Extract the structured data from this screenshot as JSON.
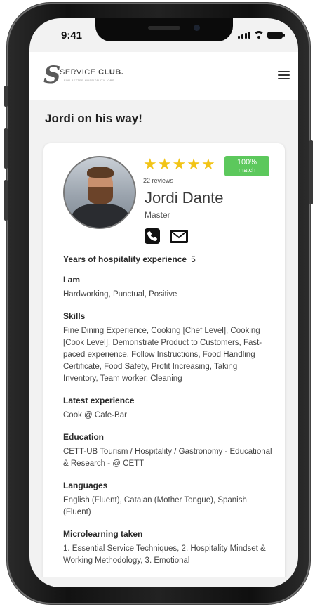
{
  "status_bar": {
    "time": "9:41"
  },
  "header": {
    "logo_mark": "S",
    "logo_primary": "SERVICE",
    "logo_bold": "CLUB.",
    "logo_tagline": "FOR BETTER HOSPITALITY JOBS"
  },
  "page": {
    "title": "Jordi on his way!"
  },
  "profile": {
    "rating": 5,
    "stars": [
      "★",
      "★",
      "★",
      "★",
      "★"
    ],
    "reviews": "22 reviews",
    "match_percent": "100%",
    "match_label": "match",
    "name": "Jordi Dante",
    "role": "Master",
    "colors": {
      "star": "#f2c417",
      "match_badge": "#5cc85c"
    }
  },
  "experience": {
    "label": "Years of hospitality experience",
    "value": "5"
  },
  "sections": [
    {
      "heading": "I am",
      "text": "Hardworking, Punctual, Positive"
    },
    {
      "heading": "Skills",
      "text": "Fine Dining Experience, Cooking [Chef Level], Cooking [Cook Level], Demonstrate Product to Customers, Fast-paced experience, Follow Instructions, Food Handling Certificate, Food Safety, Profit Increasing, Taking Inventory, Team worker, Cleaning"
    },
    {
      "heading": "Latest experience",
      "text": "Cook @ Cafe-Bar"
    },
    {
      "heading": "Education",
      "text": "CETT-UB Tourism / Hospitality / Gastronomy - Educational & Research - @ CETT"
    },
    {
      "heading": "Languages",
      "text": "English (Fluent), Catalan (Mother Tongue), Spanish (Fluent)"
    },
    {
      "heading": "Microlearning taken",
      "text": "1. Essential Service Techniques, 2. Hospitality Mindset & Working Methodology, 3. Emotional"
    }
  ]
}
